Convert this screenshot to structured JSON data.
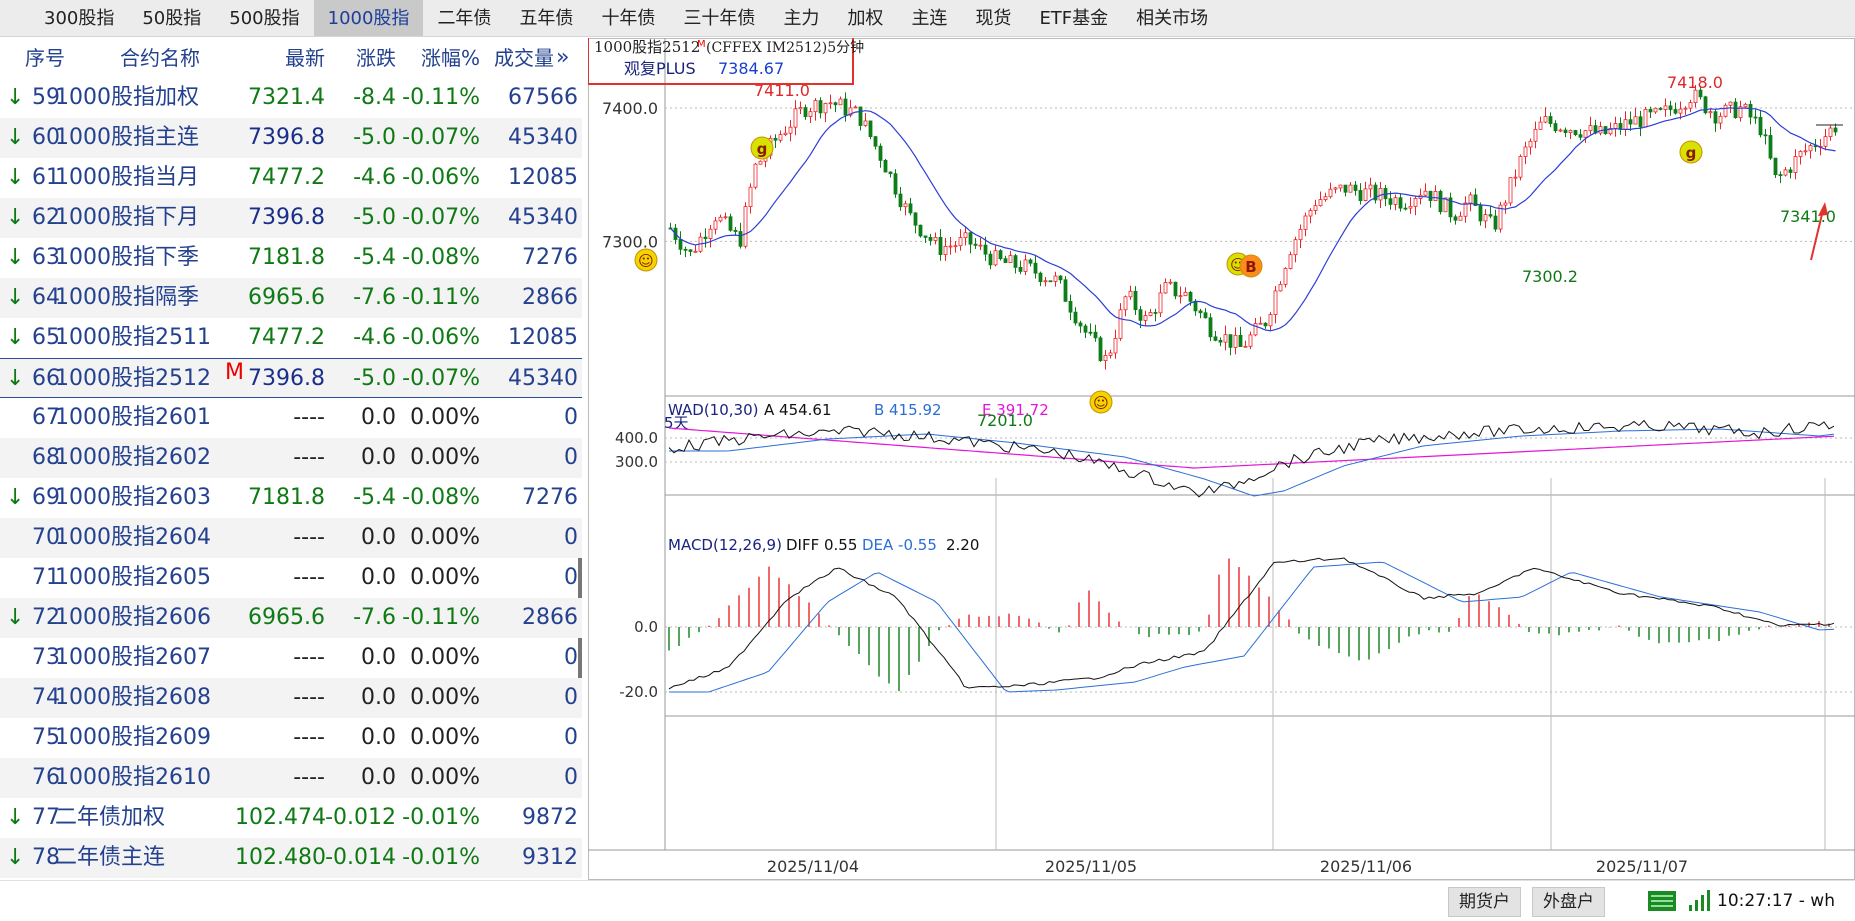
{
  "tabs": [
    "300股指",
    "50股指",
    "500股指",
    "1000股指",
    "二年债",
    "五年债",
    "十年债",
    "三十年债",
    "主力",
    "加权",
    "主连",
    "现货",
    "ETF基金",
    "相关市场"
  ],
  "active_tab": 3,
  "headers": {
    "num": "序号",
    "name": "合约名称",
    "last": "最新",
    "chg": "涨跌",
    "pct": "涨幅%",
    "vol": "成交量",
    "more": "»"
  },
  "rows": [
    {
      "arrow": "↓",
      "num": "59",
      "name": "1000股指加权",
      "last": "7321.4",
      "chg": "-8.4",
      "pct": "-0.11%",
      "vol": "67566",
      "color": "green"
    },
    {
      "arrow": "↓",
      "num": "60",
      "name": "1000股指主连",
      "last": "7396.8",
      "chg": "-5.0",
      "pct": "-0.07%",
      "vol": "45340",
      "color": "blue"
    },
    {
      "arrow": "↓",
      "num": "61",
      "name": "1000股指当月",
      "last": "7477.2",
      "chg": "-4.6",
      "pct": "-0.06%",
      "vol": "12085",
      "color": "green"
    },
    {
      "arrow": "↓",
      "num": "62",
      "name": "1000股指下月",
      "last": "7396.8",
      "chg": "-5.0",
      "pct": "-0.07%",
      "vol": "45340",
      "color": "blue"
    },
    {
      "arrow": "↓",
      "num": "63",
      "name": "1000股指下季",
      "last": "7181.8",
      "chg": "-5.4",
      "pct": "-0.08%",
      "vol": "7276",
      "color": "green"
    },
    {
      "arrow": "↓",
      "num": "64",
      "name": "1000股指隔季",
      "last": "6965.6",
      "chg": "-7.6",
      "pct": "-0.11%",
      "vol": "2866",
      "color": "green"
    },
    {
      "arrow": "↓",
      "num": "65",
      "name": "1000股指2511",
      "last": "7477.2",
      "chg": "-4.6",
      "pct": "-0.06%",
      "vol": "12085",
      "color": "green"
    },
    {
      "arrow": "↓",
      "num": "66",
      "name": "1000股指2512",
      "sup": "M",
      "last": "7396.8",
      "chg": "-5.0",
      "pct": "-0.07%",
      "vol": "45340",
      "color": "blue",
      "selected": true
    },
    {
      "arrow": "",
      "num": "67",
      "name": "1000股指2601",
      "last": "----",
      "chg": "0.0",
      "pct": "0.00%",
      "vol": "0",
      "color": "dark"
    },
    {
      "arrow": "",
      "num": "68",
      "name": "1000股指2602",
      "last": "----",
      "chg": "0.0",
      "pct": "0.00%",
      "vol": "0",
      "color": "dark"
    },
    {
      "arrow": "↓",
      "num": "69",
      "name": "1000股指2603",
      "last": "7181.8",
      "chg": "-5.4",
      "pct": "-0.08%",
      "vol": "7276",
      "color": "green"
    },
    {
      "arrow": "",
      "num": "70",
      "name": "1000股指2604",
      "last": "----",
      "chg": "0.0",
      "pct": "0.00%",
      "vol": "0",
      "color": "dark"
    },
    {
      "arrow": "",
      "num": "71",
      "name": "1000股指2605",
      "last": "----",
      "chg": "0.0",
      "pct": "0.00%",
      "vol": "0",
      "color": "dark"
    },
    {
      "arrow": "↓",
      "num": "72",
      "name": "1000股指2606",
      "last": "6965.6",
      "chg": "-7.6",
      "pct": "-0.11%",
      "vol": "2866",
      "color": "green"
    },
    {
      "arrow": "",
      "num": "73",
      "name": "1000股指2607",
      "last": "----",
      "chg": "0.0",
      "pct": "0.00%",
      "vol": "0",
      "color": "dark"
    },
    {
      "arrow": "",
      "num": "74",
      "name": "1000股指2608",
      "last": "----",
      "chg": "0.0",
      "pct": "0.00%",
      "vol": "0",
      "color": "dark"
    },
    {
      "arrow": "",
      "num": "75",
      "name": "1000股指2609",
      "last": "----",
      "chg": "0.0",
      "pct": "0.00%",
      "vol": "0",
      "color": "dark"
    },
    {
      "arrow": "",
      "num": "76",
      "name": "1000股指2610",
      "last": "----",
      "chg": "0.0",
      "pct": "0.00%",
      "vol": "0",
      "color": "dark"
    },
    {
      "arrow": "↓",
      "num": "77",
      "name": "二年债加权",
      "last": "102.474",
      "chg": "-0.012",
      "pct": "-0.01%",
      "vol": "9872",
      "color": "green"
    },
    {
      "arrow": "↓",
      "num": "78",
      "name": "二年债主连",
      "last": "102.480",
      "chg": "-0.014",
      "pct": "-0.01%",
      "vol": "9312",
      "color": "green"
    }
  ],
  "chart": {
    "title": "1000股指2512",
    "title_sup": "M",
    "title_rest": "(CFFEX IM2512)5分钟",
    "indicator_name": "观复PLUS",
    "indicator_value": "7384.67",
    "period_label": "5天",
    "y_labels": [
      "7400.0",
      "7300.0"
    ],
    "annotations": [
      "7411.0",
      "7418.0",
      "7201.0",
      "7300.2",
      "7341.0"
    ],
    "wad": {
      "label": "WAD(10,30)",
      "a": "A 454.61",
      "b": "B 415.92",
      "e": "E 391.72",
      "y_labels": [
        "400.0",
        "300.0"
      ]
    },
    "macd": {
      "label": "MACD(12,26,9)",
      "diff": "DIFF 0.55",
      "dea": "DEA -0.55",
      "macd": "2.20",
      "y_labels": [
        "0.0",
        "-20.0"
      ]
    },
    "dates": [
      "2025/11/04",
      "2025/11/05",
      "2025/11/06",
      "2025/11/07"
    ],
    "colors": {
      "up": "#e8262a",
      "down": "#0d7d18",
      "ma": "#2a3fd6",
      "wad_b": "#2a6fd6",
      "wad_e": "#e316d8",
      "highlight": "#e0332e"
    }
  },
  "chart_data": {
    "type": "candlestick",
    "ylim": [
      7190,
      7430
    ],
    "x": [
      "2025/11/04",
      "2025/11/05",
      "2025/11/06",
      "2025/11/07"
    ],
    "extremes": [
      7411.0,
      7418.0,
      7201.0,
      7300.2,
      7341.0
    ],
    "series": [
      {
        "name": "WAD(10,30)",
        "values": [
          454.61
        ]
      },
      {
        "name": "MACD(12,26,9)",
        "values": [
          2.2
        ]
      }
    ]
  },
  "status": {
    "btn1": "期货户",
    "btn2": "外盘户",
    "clock": "10:27:17 - wh"
  }
}
